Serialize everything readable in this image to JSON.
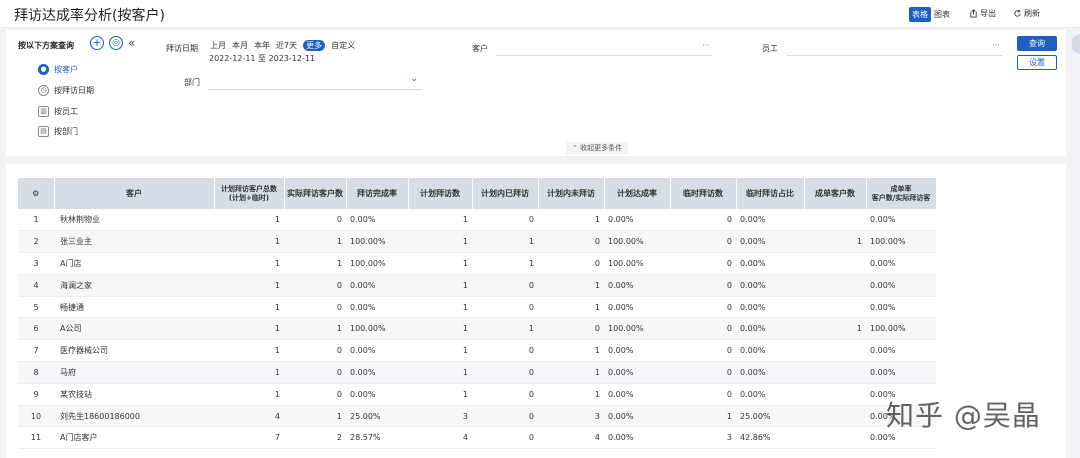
{
  "header": {
    "title": "拜访达成率分析(按客户)",
    "view_table": "表格",
    "view_chart": "图表",
    "export": "导出",
    "refresh": "刷新"
  },
  "filter": {
    "scheme_title": "按以下方案查询",
    "add_symbol": "+",
    "settings_symbol": "◎",
    "collapse_symbol": "«",
    "schemes": [
      "按客户",
      "按拜访日期",
      "按员工",
      "按部门"
    ],
    "visit_date_label": "拜访日期",
    "date_options": [
      "上月",
      "本月",
      "本年",
      "近7天",
      "更多",
      "自定义"
    ],
    "date_range": "2022-12-11 至 2023-12-11",
    "customer_label": "客户",
    "employee_label": "员工",
    "department_label": "部门",
    "dots": "···",
    "query_button": "查询",
    "settings_button": "设置",
    "collapse_more": "收起更多条件"
  },
  "table": {
    "columns": [
      "客户",
      "计划拜访客户总数\n(计划+临时)",
      "实际拜访客户数",
      "拜访完成率",
      "计划拜访数",
      "计划内已拜访",
      "计划内未拜访",
      "计划达成率",
      "临时拜访数",
      "临时拜访占比",
      "成单客户数",
      "成单率\n客户数/实际拜访客"
    ],
    "rows": [
      [
        "1",
        "秋林荆物业",
        "1",
        "0",
        "0.00%",
        "1",
        "0",
        "1",
        "0.00%",
        "0",
        "0.00%",
        "",
        "0.00%"
      ],
      [
        "2",
        "张三业主",
        "1",
        "1",
        "100.00%",
        "1",
        "1",
        "0",
        "100.00%",
        "0",
        "0.00%",
        "1",
        "100.00%"
      ],
      [
        "3",
        "A门店",
        "1",
        "1",
        "100.00%",
        "1",
        "1",
        "0",
        "100.00%",
        "0",
        "0.00%",
        "",
        "0.00%"
      ],
      [
        "4",
        "海澜之家",
        "1",
        "0",
        "0.00%",
        "1",
        "0",
        "1",
        "0.00%",
        "0",
        "0.00%",
        "",
        "0.00%"
      ],
      [
        "5",
        "畅捷通",
        "1",
        "0",
        "0.00%",
        "1",
        "0",
        "1",
        "0.00%",
        "0",
        "0.00%",
        "",
        "0.00%"
      ],
      [
        "6",
        "A公司",
        "1",
        "1",
        "100.00%",
        "1",
        "1",
        "0",
        "100.00%",
        "0",
        "0.00%",
        "1",
        "100.00%"
      ],
      [
        "7",
        "医疗器械公司",
        "1",
        "0",
        "0.00%",
        "1",
        "0",
        "1",
        "0.00%",
        "0",
        "0.00%",
        "",
        "0.00%"
      ],
      [
        "8",
        "马府",
        "1",
        "0",
        "0.00%",
        "1",
        "0",
        "1",
        "0.00%",
        "0",
        "0.00%",
        "",
        "0.00%"
      ],
      [
        "9",
        "某农技站",
        "1",
        "0",
        "0.00%",
        "1",
        "0",
        "1",
        "0.00%",
        "0",
        "0.00%",
        "",
        "0.00%"
      ],
      [
        "10",
        "刘先生18600186000",
        "4",
        "1",
        "25.00%",
        "3",
        "0",
        "3",
        "0.00%",
        "1",
        "25.00%",
        "",
        "0.00%"
      ],
      [
        "11",
        "A门店客户",
        "7",
        "2",
        "28.57%",
        "4",
        "0",
        "4",
        "0.00%",
        "3",
        "42.86%",
        "",
        "0.00%"
      ]
    ]
  },
  "watermark": "知乎 @吴晶",
  "colors": {
    "accent": "#1f5fbf",
    "header_bg": "#d7dde6"
  }
}
